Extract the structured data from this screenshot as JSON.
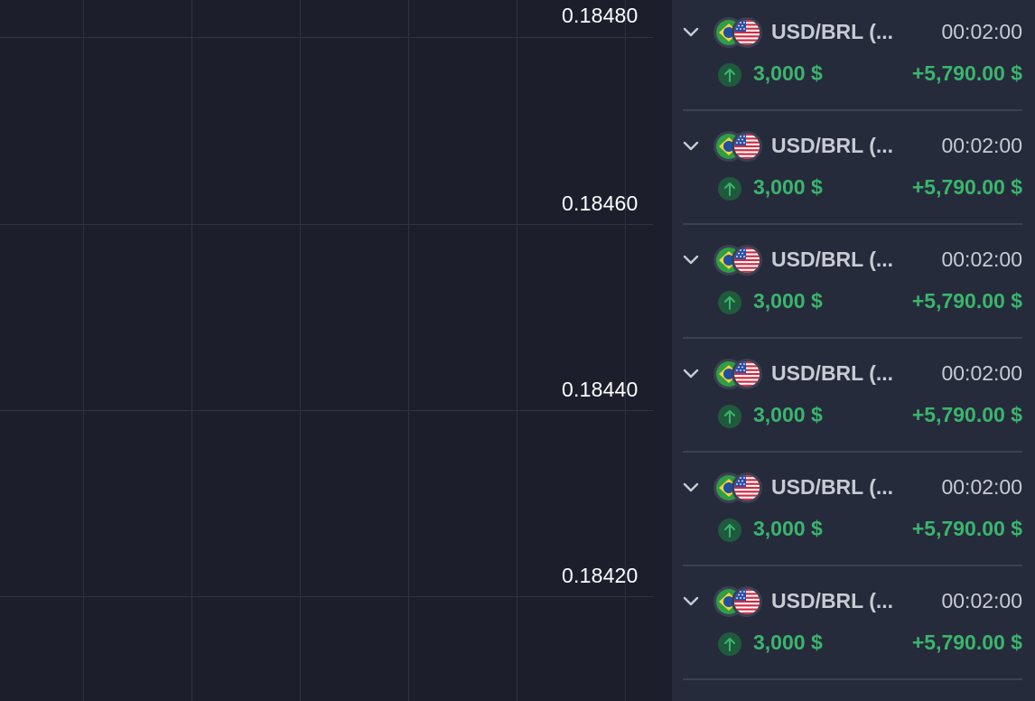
{
  "chart": {
    "price_levels": [
      {
        "value": "0.18480"
      },
      {
        "value": "0.18460"
      },
      {
        "value": "0.18440"
      },
      {
        "value": "0.18420"
      }
    ]
  },
  "colors": {
    "chart_bg": "#1c1f2b",
    "panel_bg": "#262b3b",
    "profit_green": "#3ab56d",
    "text_light": "#c8cbd4"
  },
  "trades": [
    {
      "pair": "USD/BRL (...",
      "time": "00:02:00",
      "direction_icon": "arrow-up-icon",
      "amount": "3,000 $",
      "profit": "+5,790.00 $"
    },
    {
      "pair": "USD/BRL (...",
      "time": "00:02:00",
      "direction_icon": "arrow-up-icon",
      "amount": "3,000 $",
      "profit": "+5,790.00 $"
    },
    {
      "pair": "USD/BRL (...",
      "time": "00:02:00",
      "direction_icon": "arrow-up-icon",
      "amount": "3,000 $",
      "profit": "+5,790.00 $"
    },
    {
      "pair": "USD/BRL (...",
      "time": "00:02:00",
      "direction_icon": "arrow-up-icon",
      "amount": "3,000 $",
      "profit": "+5,790.00 $"
    },
    {
      "pair": "USD/BRL (...",
      "time": "00:02:00",
      "direction_icon": "arrow-up-icon",
      "amount": "3,000 $",
      "profit": "+5,790.00 $"
    },
    {
      "pair": "USD/BRL (...",
      "time": "00:02:00",
      "direction_icon": "arrow-up-icon",
      "amount": "3,000 $",
      "profit": "+5,790.00 $"
    }
  ]
}
